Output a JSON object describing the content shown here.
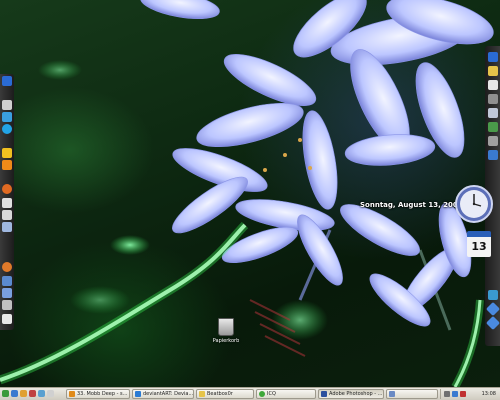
{
  "desktop": {
    "date_text": "Sonntag, August 13, 2006",
    "calendar_day": "13",
    "recycle_bin_label": "Papierkorb",
    "clock_time": "13:08"
  },
  "taskbar": {
    "tasks": [
      {
        "label": "33. Mobb Deep - s...",
        "icon": "winamp-icon",
        "color": "#e08a1a"
      },
      {
        "label": "deviantART: Devia...",
        "icon": "browser-icon",
        "color": "#2a7bd4"
      },
      {
        "label": "Beatbox0r",
        "icon": "folder-icon",
        "color": "#e6c44a"
      },
      {
        "label": "ICQ",
        "icon": "icq-icon",
        "color": "#3ea83a"
      },
      {
        "label": "Adobe Photoshop - ...",
        "icon": "photoshop-icon",
        "color": "#2b4f9e"
      },
      {
        "label": "",
        "icon": "window-icon",
        "color": "#6a8ac4"
      }
    ],
    "tray_time": "13:08"
  },
  "colors": {
    "flower": "#c9d4ff",
    "flower_shade": "#6d78d8",
    "sparkle_green": "#3cff5a",
    "taskbar": "#dedbd0"
  }
}
